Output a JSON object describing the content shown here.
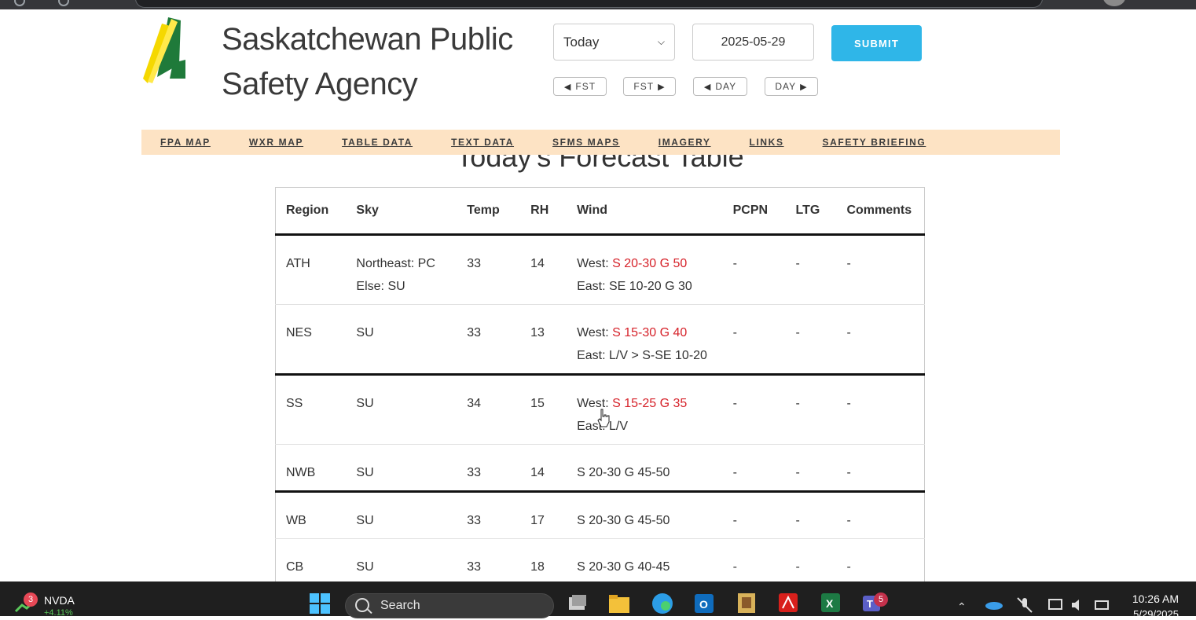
{
  "header": {
    "title_line1": "Saskatchewan Public",
    "title_line2": "Safety Agency",
    "period_select": "Today",
    "date_value": "2025-05-29",
    "submit_label": "SUBMIT",
    "nav_buttons": [
      {
        "label": "FST",
        "dir": "◀"
      },
      {
        "label": "FST",
        "dir": "▶"
      },
      {
        "label": "DAY",
        "dir": "◀"
      },
      {
        "label": "DAY",
        "dir": "▶"
      }
    ]
  },
  "main_nav": [
    "FPA MAP",
    "WXR MAP",
    "TABLE DATA",
    "TEXT DATA",
    "SFMS MAPS",
    "IMAGERY",
    "LINKS",
    "SAFETY BRIEFING"
  ],
  "section_heading": "Today's Forecast Table",
  "table": {
    "headers": [
      "Region",
      "Sky",
      "Temp",
      "RH",
      "Wind",
      "PCPN",
      "LTG",
      "Comments"
    ],
    "rows": [
      {
        "region": "ATH",
        "sky1": "Northeast: PC",
        "sky2": "Else: SU",
        "temp": "33",
        "rh": "14",
        "wind1_label": "West: ",
        "wind1_value": "S 20-30 G 50",
        "wind2_label": "East: SE 10-20 G 30",
        "pcpn": "-",
        "ltg": "-",
        "comments": "-"
      },
      {
        "region": "NES",
        "sky1": "SU",
        "sky2": "",
        "temp": "33",
        "rh": "13",
        "wind1_label": "West: ",
        "wind1_value": "S 15-30 G 40",
        "wind2_label": "East: L/V > S-SE 10-20",
        "pcpn": "-",
        "ltg": "-",
        "comments": "-"
      },
      {
        "region": "SS",
        "sky1": "SU",
        "sky2": "",
        "temp": "34",
        "rh": "15",
        "wind1_label": "West: ",
        "wind1_value": "S 15-25 G 35",
        "wind2_label": "East: L/V",
        "pcpn": "-",
        "ltg": "-",
        "comments": "-"
      },
      {
        "region": "NWB",
        "sky1": "SU",
        "temp": "33",
        "rh": "14",
        "wind_value": "S 20-30 G 45-50",
        "pcpn": "-",
        "ltg": "-",
        "comments": "-"
      },
      {
        "region": "WB",
        "sky1": "SU",
        "temp": "33",
        "rh": "17",
        "wind_value": "S 20-30 G 45-50",
        "pcpn": "-",
        "ltg": "-",
        "comments": "-"
      },
      {
        "region": "CB",
        "sky1": "SU",
        "temp": "33",
        "rh": "18",
        "wind_value": "S 20-30 G 40-45",
        "pcpn": "-",
        "ltg": "-",
        "comments": "-"
      }
    ]
  },
  "taskbar": {
    "stock_ticker": "NVDA",
    "stock_change": "+4.11%",
    "stock_badge": "3",
    "search_placeholder": "Search",
    "teams_badge": "5",
    "time": "10:26 AM",
    "date": "5/29/2025"
  },
  "colors": {
    "accent_red": "#d6222a",
    "submit_blue": "#2fb6e8",
    "nav_bg": "#fde3c4"
  }
}
